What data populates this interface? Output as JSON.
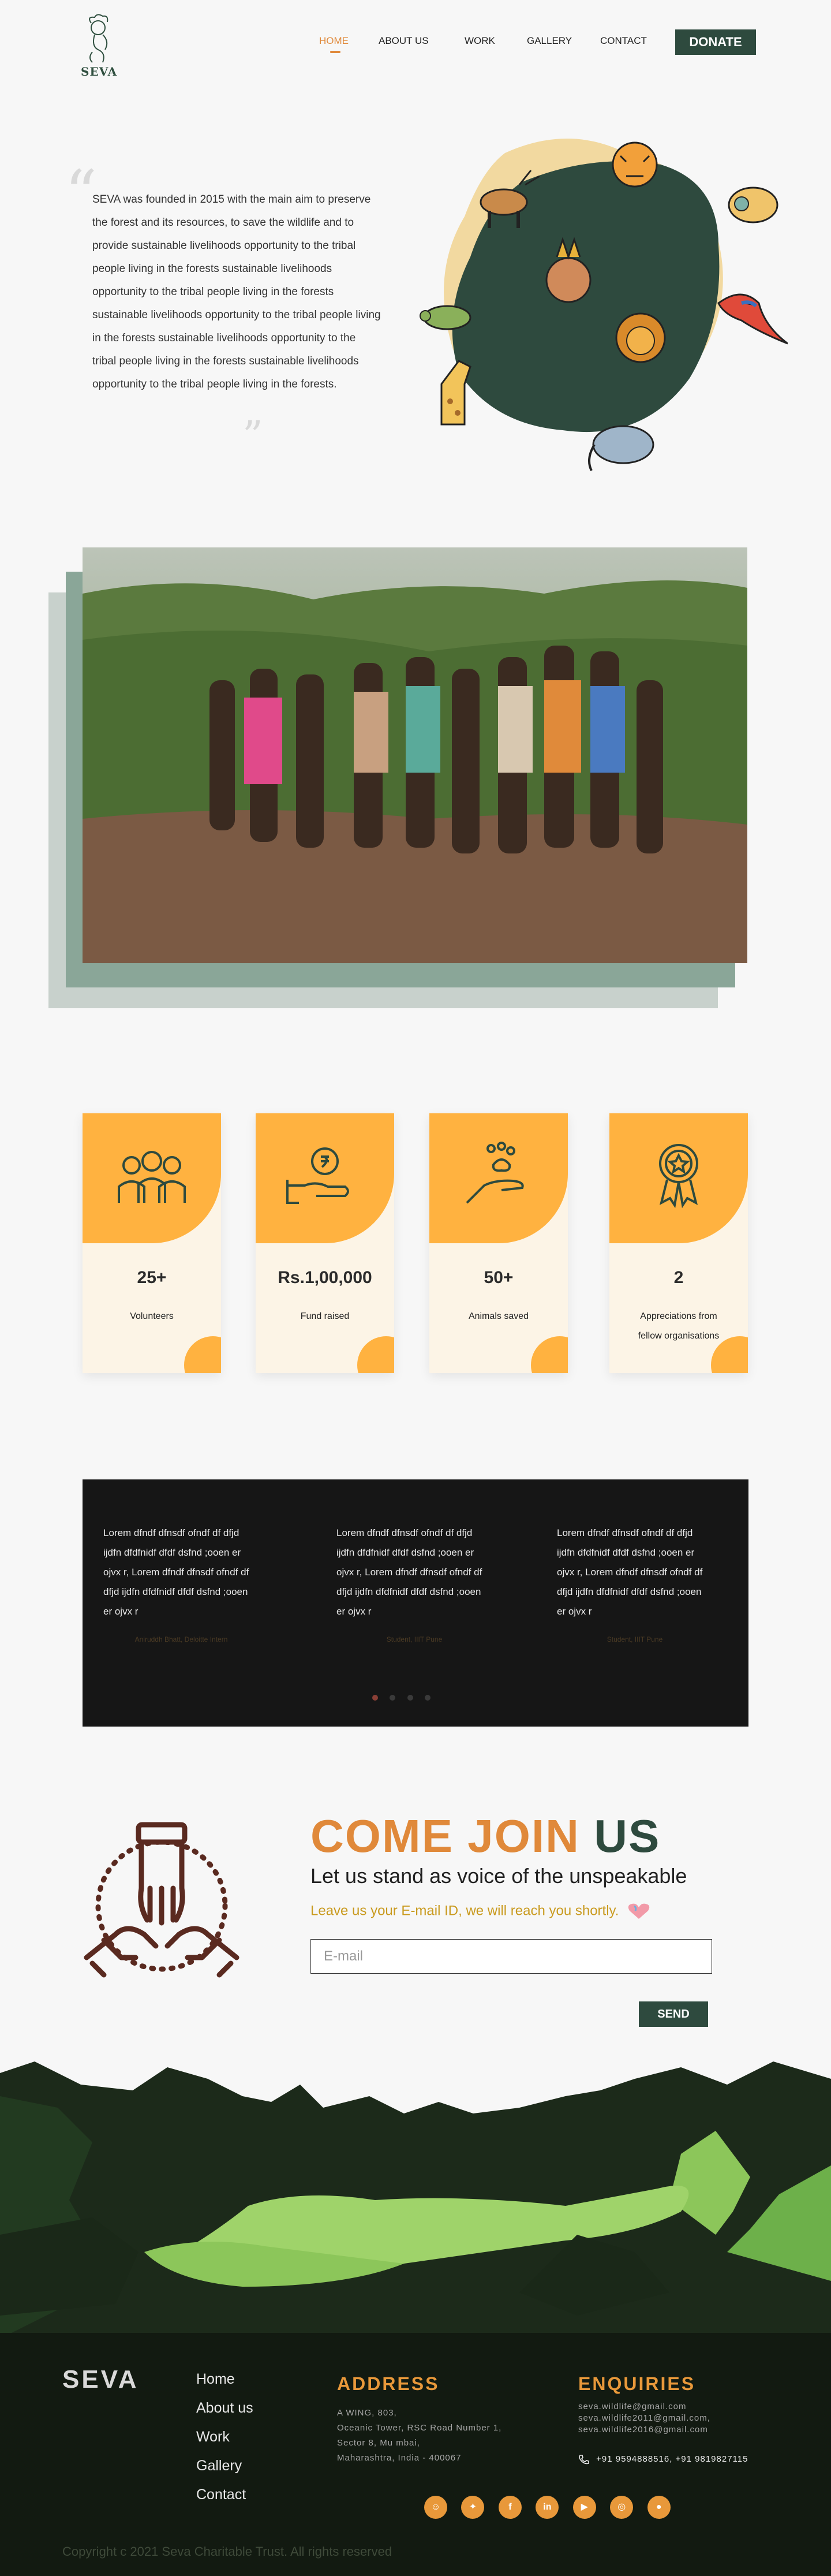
{
  "colors": {
    "accent": "#e0893a",
    "brand_green": "#2e4a3e",
    "card_orange": "#ffb240",
    "card_bg": "#fcf4e6",
    "footer_bg": "#121a11"
  },
  "header": {
    "logo_text": "SEVA",
    "nav": [
      {
        "label": "HOME",
        "active": true
      },
      {
        "label": "ABOUT US",
        "active": false
      },
      {
        "label": "WORK",
        "active": false
      },
      {
        "label": "GALLERY",
        "active": false
      },
      {
        "label": "CONTACT",
        "active": false
      }
    ],
    "donate_label": "DONATE"
  },
  "about": {
    "quote_open": "“",
    "quote_close": "”",
    "text": "SEVA was founded in 2015 with the main aim to preserve the forest and its resources, to save the wildlife and to provide sustainable livelihoods opportunity to the tribal people living in the forests sustainable livelihoods opportunity to the tribal people living in the forests sustainable livelihoods opportunity to the tribal people living in the forests sustainable livelihoods opportunity to the tribal people living in the forests sustainable livelihoods opportunity to the tribal people living in the forests."
  },
  "stats": [
    {
      "value": "25+",
      "label": "Volunteers",
      "icon": "group-icon"
    },
    {
      "value": "Rs.1,00,000",
      "label": "Fund raised",
      "icon": "money-hand-icon"
    },
    {
      "value": "50+",
      "label": "Animals saved",
      "icon": "paw-hand-icon"
    },
    {
      "value": "2",
      "label": "Appreciations from fellow organisations",
      "icon": "award-badge-icon"
    }
  ],
  "testimonials": [
    {
      "text": "Lorem  dfndf dfnsdf ofndf df dfjd ijdfn dfdfnidf dfdf dsfnd ;ooen er ojvx r, Lorem  dfndf dfnsdf ofndf df dfjd ijdfn dfdfnidf dfdf dsfnd ;ooen er ojvx r",
      "author": "Aniruddh Bhatt, Deloitte Intern"
    },
    {
      "text": "Lorem  dfndf dfnsdf ofndf df dfjd ijdfn dfdfnidf dfdf dsfnd ;ooen er ojvx r, Lorem  dfndf dfnsdf ofndf df dfjd ijdfn dfdfnidf dfdf dsfnd ;ooen er ojvx r",
      "author": "Student, IIIT Pune"
    },
    {
      "text": "Lorem  dfndf dfnsdf ofndf df dfjd ijdfn dfdfnidf dfdf dsfnd ;ooen er ojvx r, Lorem  dfndf dfnsdf ofndf df dfjd ijdfn dfdfnidf dfdf dsfnd ;ooen er ojvx r",
      "author": "Student, IIIT Pune"
    }
  ],
  "join": {
    "title_part1": "COME JOIN",
    "title_part2": "US",
    "subtitle": "Let us stand as voice of the unspeakable",
    "note": "Leave us your E-mail ID, we will reach you shortly.",
    "email_placeholder": "E-mail",
    "send_label": "SEND"
  },
  "footer": {
    "brand": "SEVA",
    "links": [
      "Home",
      "About us",
      "Work",
      "Gallery",
      "Contact"
    ],
    "address_heading": "ADDRESS",
    "address_lines": [
      "A WING, 803,",
      "Oceanic Tower, RSC Road Number 1,",
      "Sector 8, Mu mbai,",
      "Maharashtra, India - 400067"
    ],
    "enquiries_heading": "ENQUIRIES",
    "emails": [
      "seva.wildlife@gmail.com",
      "seva.wildlife2011@gmail.com,",
      "seva.wildlife2016@gmail.com"
    ],
    "phones": "+91 9594888516, +91 9819827115",
    "socials": [
      "snapchat-icon",
      "twitter-icon",
      "facebook-icon",
      "linkedin-icon",
      "youtube-icon",
      "instagram-icon",
      "reddit-icon"
    ],
    "copyright": "Copyright  c 2021 Seva Charitable Trust. All rights reserved"
  }
}
